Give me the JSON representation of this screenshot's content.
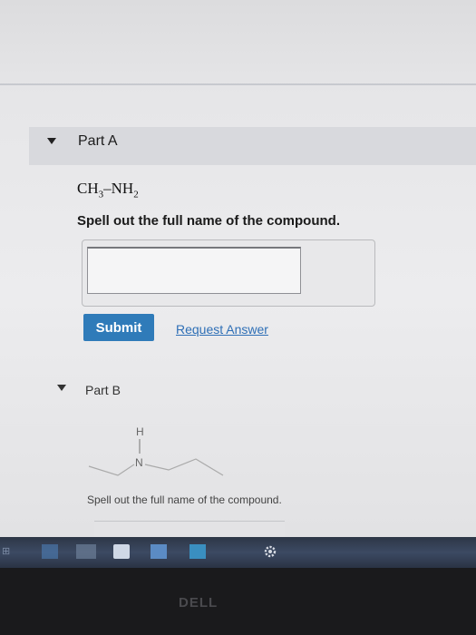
{
  "part_a": {
    "title": "Part A",
    "formula": {
      "left": "CH",
      "left_sub": "3",
      "bond": "–",
      "right": "NH",
      "right_sub": "2"
    },
    "prompt": "Spell out the full name of the compound.",
    "answer_value": "",
    "submit_label": "Submit",
    "request_answer_label": "Request Answer"
  },
  "part_b": {
    "title": "Part B",
    "molecule_atoms": {
      "h": "H",
      "n": "N"
    },
    "prompt": "Spell out the full name of the compound."
  },
  "taskbar": {
    "start_label": "⊞"
  },
  "bezel": {
    "logo": "DELL"
  },
  "colors": {
    "accent": "#2f7bb9",
    "link": "#2e6fb6",
    "taskbar": "#3c4a63"
  },
  "icons": [
    "caret-down-icon",
    "gear-icon",
    "store-icon",
    "mail-icon",
    "photos-icon"
  ]
}
